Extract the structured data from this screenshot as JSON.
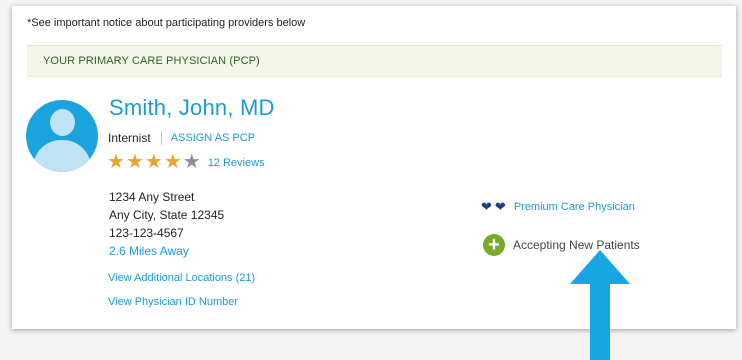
{
  "notice": "*See important notice about participating providers below",
  "pcp_banner": "YOUR PRIMARY CARE PHYSICIAN (PCP)",
  "physician": {
    "name": "Smith, John, MD",
    "specialty": "Internist",
    "assign_label": "ASSIGN AS PCP",
    "rating": {
      "value": 4,
      "max": 5
    },
    "reviews": "12 Reviews",
    "address": {
      "street": "1234 Any Street",
      "city_state": "Any City, State  12345",
      "phone": "123-123-4567",
      "distance": "2.6 Miles Away"
    },
    "additional_locations": "View Additional Locations (21)",
    "physician_id_link": "View Physician ID Number",
    "premium_label": "Premium Care Physician",
    "accepting_label": "Accepting New Patients"
  },
  "colors": {
    "link_blue": "#1b9ad5",
    "star_gold": "#e6a52e",
    "star_gray": "#8a8f99",
    "heart_navy": "#1a3f86",
    "plus_green": "#79aa2c",
    "arrow_blue": "#17a6e3"
  },
  "icons": {
    "avatar": "person-silhouette-icon",
    "heart": "heart-icon",
    "plus": "plus-circle-icon",
    "arrow": "arrow-up-icon"
  }
}
